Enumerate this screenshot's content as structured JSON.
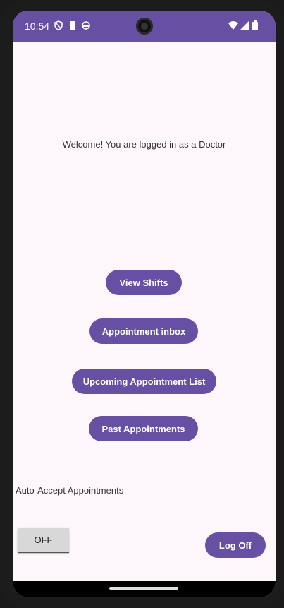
{
  "status_bar": {
    "time": "10:54",
    "icons_left": [
      "shield-icon",
      "sd-card-icon",
      "circle-icon"
    ],
    "icons_right": [
      "wifi-icon",
      "signal-icon",
      "battery-icon"
    ],
    "color": "#6750a4"
  },
  "main": {
    "welcome_text": "Welcome! You are logged in as a Doctor",
    "buttons": {
      "view_shifts": "View Shifts",
      "appointment_inbox": "Appointment inbox",
      "upcoming_list": "Upcoming Appointment List",
      "past_appointments": "Past Appointments"
    },
    "auto_accept_label": "Auto-Accept Appointments",
    "auto_accept_state": "OFF",
    "log_off": "Log Off"
  },
  "colors": {
    "accent": "#6750a4",
    "background": "#fdf7fc"
  }
}
